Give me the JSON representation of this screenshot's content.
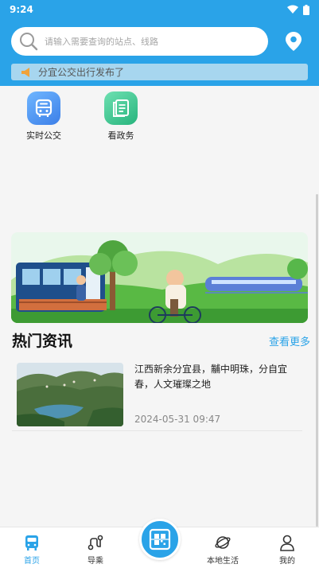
{
  "status_bar": {
    "time": "9:24"
  },
  "search": {
    "placeholder": "请输入需要查询的站点、线路"
  },
  "notice": {
    "text": "分宜公交出行发布了"
  },
  "shortcuts": [
    {
      "label": "实时公交",
      "icon": "bus-icon"
    },
    {
      "label": "看政务",
      "icon": "document-icon"
    }
  ],
  "news_section": {
    "title": "热门资讯",
    "more_label": "查看更多",
    "items": [
      {
        "title": "江西新余分宜县，黼中明珠，分自宜春，人文璀璨之地",
        "date": "2024-05-31 09:47"
      }
    ]
  },
  "bottom_nav": {
    "items": [
      {
        "label": "首页",
        "icon": "bus-icon",
        "active": true
      },
      {
        "label": "导乘",
        "icon": "route-icon",
        "active": false
      },
      {
        "label": "",
        "icon": "qr-scan-icon",
        "active": false
      },
      {
        "label": "本地生活",
        "icon": "planet-icon",
        "active": false
      },
      {
        "label": "我的",
        "icon": "person-icon",
        "active": false
      }
    ]
  },
  "colors": {
    "brand": "#2aa3e8",
    "notice_bg": "#a7d6ef"
  }
}
